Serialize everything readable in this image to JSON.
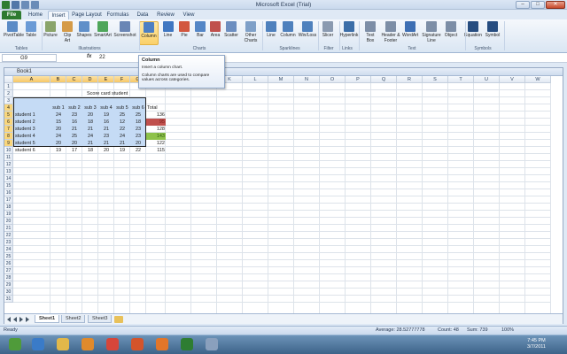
{
  "window": {
    "title": "Microsoft Excel (Trial)"
  },
  "tabs": [
    "File",
    "Home",
    "Insert",
    "Page Layout",
    "Formulas",
    "Data",
    "Review",
    "View"
  ],
  "active_tab": "Insert",
  "ribbon": {
    "buttons": [
      {
        "label": "PivotTable",
        "icon": "pivottable-icon",
        "color": "#5b8bc6"
      },
      {
        "label": "Table",
        "icon": "table-icon",
        "color": "#6b9bd6"
      },
      {
        "label": "Picture",
        "icon": "picture-icon",
        "color": "#8aa46a"
      },
      {
        "label": "Clip Art",
        "icon": "clipart-icon",
        "color": "#d59b48"
      },
      {
        "label": "Shapes",
        "icon": "shapes-icon",
        "color": "#5f8fc9"
      },
      {
        "label": "SmartArt",
        "icon": "smartart-icon",
        "color": "#4ea65a"
      },
      {
        "label": "Screenshot",
        "icon": "screenshot-icon",
        "color": "#6a86b5"
      },
      {
        "label": "Column",
        "icon": "column-chart-icon",
        "color": "#4c7fc4",
        "selected": true
      },
      {
        "label": "Line",
        "icon": "line-chart-icon",
        "color": "#3f77c2"
      },
      {
        "label": "Pie",
        "icon": "pie-chart-icon",
        "color": "#d2573f"
      },
      {
        "label": "Bar",
        "icon": "bar-chart-icon",
        "color": "#5486c6"
      },
      {
        "label": "Area",
        "icon": "area-chart-icon",
        "color": "#c0504d"
      },
      {
        "label": "Scatter",
        "icon": "scatter-chart-icon",
        "color": "#6c8ec0"
      },
      {
        "label": "Other Charts",
        "icon": "other-charts-icon",
        "color": "#7fa0c8"
      },
      {
        "label": "Line",
        "icon": "sparkline-line-icon",
        "color": "#4f81bd"
      },
      {
        "label": "Column",
        "icon": "sparkline-column-icon",
        "color": "#4f81bd"
      },
      {
        "label": "Win/Loss",
        "icon": "sparkline-winloss-icon",
        "color": "#4f81bd"
      },
      {
        "label": "Slicer",
        "icon": "slicer-icon",
        "color": "#8a9ab0"
      },
      {
        "label": "Hyperlink",
        "icon": "hyperlink-icon",
        "color": "#3c6ea8"
      },
      {
        "label": "Text Box",
        "icon": "textbox-icon",
        "color": "#7d8ea6"
      },
      {
        "label": "Header & Footer",
        "icon": "header-footer-icon",
        "color": "#7d8ea6"
      },
      {
        "label": "WordArt",
        "icon": "wordart-icon",
        "color": "#3e6fb3"
      },
      {
        "label": "Signature Line",
        "icon": "signature-line-icon",
        "color": "#7d8ea6"
      },
      {
        "label": "Object",
        "icon": "object-icon",
        "color": "#7d8ea6"
      },
      {
        "label": "Equation",
        "icon": "equation-icon",
        "color": "#274d80"
      },
      {
        "label": "Symbol",
        "icon": "symbol-icon",
        "color": "#274d80"
      }
    ],
    "groups": [
      "Tables",
      "Illustrations",
      "Charts",
      "Sparklines",
      "Filter",
      "Links",
      "Text",
      "Symbols"
    ]
  },
  "formula_bar": {
    "name_box": "G9",
    "fx": "fx",
    "value": "22"
  },
  "tooltip": {
    "title": "Column",
    "line1": "Insert a column chart.",
    "line2": "Column charts are used to compare values across categories."
  },
  "workbook": {
    "name": "Book1"
  },
  "columns": [
    "A",
    "B",
    "C",
    "D",
    "E",
    "F",
    "G",
    "H",
    "I",
    "J",
    "K",
    "L",
    "M",
    "N",
    "O",
    "P",
    "Q",
    "R",
    "S",
    "T",
    "U",
    "V",
    "W"
  ],
  "rows": [
    "1",
    "2",
    "3",
    "4",
    "5",
    "6",
    "7",
    "8",
    "9",
    "10",
    "11",
    "12",
    "13",
    "14",
    "15",
    "16",
    "17",
    "18",
    "19",
    "20",
    "21",
    "22",
    "23",
    "24",
    "25",
    "26",
    "27",
    "28",
    "29",
    "30",
    "31"
  ],
  "sheet": {
    "title": "Score card student",
    "headers": [
      "sub 1",
      "sub 2",
      "sub 3",
      "sub 4",
      "sub 5",
      "sub 6",
      "Total"
    ],
    "students": [
      {
        "name": "student 1",
        "scores": [
          24,
          23,
          20,
          19,
          25,
          25
        ],
        "total": 136
      },
      {
        "name": "student 2",
        "scores": [
          15,
          16,
          18,
          16,
          12,
          18
        ],
        "total": 95
      },
      {
        "name": "student 3",
        "scores": [
          20,
          21,
          21,
          21,
          22,
          23
        ],
        "total": 128
      },
      {
        "name": "student 4",
        "scores": [
          24,
          25,
          24,
          23,
          24,
          23
        ],
        "total": 143
      },
      {
        "name": "student 5",
        "scores": [
          20,
          20,
          21,
          21,
          21,
          20
        ],
        "total": 122
      },
      {
        "name": "student 6",
        "scores": [
          19,
          17,
          18,
          20,
          19,
          22
        ],
        "total": 115
      }
    ],
    "colors": {
      "selection": "#c5dbf5",
      "low_total": "#c0504d",
      "high_total": "#8ec24b"
    }
  },
  "sheet_tabs": [
    "Sheet1",
    "Sheet2",
    "Sheet3"
  ],
  "active_sheet": "Sheet1",
  "status": {
    "mode": "Ready",
    "average": "Average: 28.52777778",
    "count": "Count: 48",
    "sum": "Sum: 739",
    "zoom": "100%"
  },
  "taskbar": {
    "apps": [
      {
        "icon": "start-orb-icon",
        "color": "#4f9b3a"
      },
      {
        "icon": "internet-explorer-icon",
        "color": "#3a7bc8"
      },
      {
        "icon": "explorer-folder-icon",
        "color": "#e2b84a"
      },
      {
        "icon": "media-player-icon",
        "color": "#e08a2c"
      },
      {
        "icon": "chrome-icon",
        "color": "#d6463a"
      },
      {
        "icon": "powerpoint-icon",
        "color": "#d4542b"
      },
      {
        "icon": "firefox-icon",
        "color": "#e2762a"
      },
      {
        "icon": "excel-icon",
        "color": "#2e7d32"
      },
      {
        "icon": "other-app-icon",
        "color": "#8aa0bd"
      }
    ],
    "time": "7:45 PM",
    "date": "3/7/2011"
  }
}
